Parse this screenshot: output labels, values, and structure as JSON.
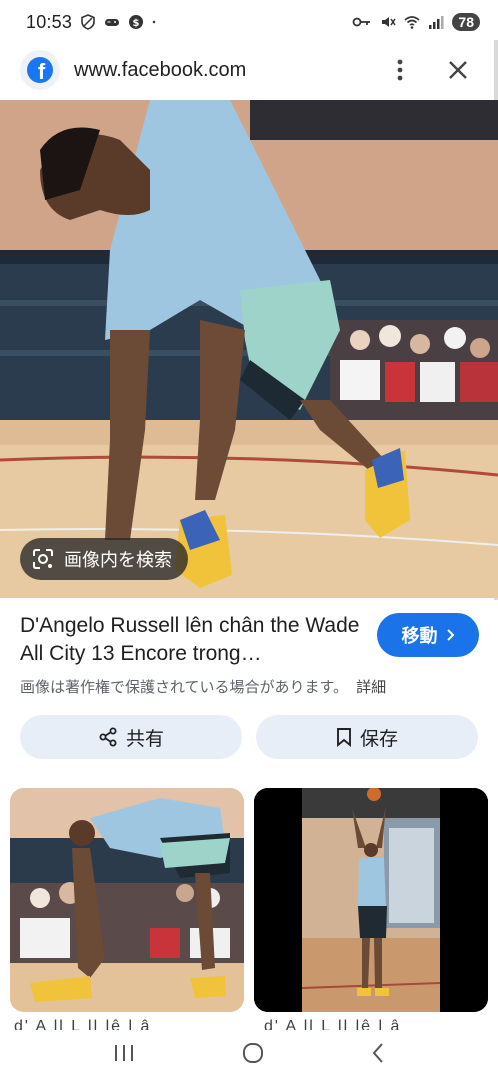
{
  "status_bar": {
    "time": "10:53",
    "battery": "78",
    "left_icons": [
      "shield-icon",
      "game-controller-icon",
      "dollar-circle-icon",
      "dot-icon"
    ],
    "right_icons": [
      "key-icon",
      "mute-icon",
      "wifi-icon",
      "signal-icon"
    ]
  },
  "browser": {
    "url": "www.facebook.com",
    "site_icon": "facebook-logo",
    "menu_icon": "more-vert-icon",
    "close_icon": "close-icon"
  },
  "image_viewer": {
    "lens_label": "画像内を検索",
    "title": "D'Angelo Russell lên chân the Wade All City 13 Encore trong…",
    "visit_label": "移動",
    "copyright_notice": "画像は著作権で保護されている場合があります。",
    "details_link": "詳細",
    "share_label": "共有",
    "save_label": "保存"
  },
  "related": {
    "captions": [
      "d' A ll L ll lê l â",
      "d' A ll L ll lê l â"
    ]
  },
  "colors": {
    "accent": "#1a73e8",
    "chip_bg": "#e8eef8",
    "facebook": "#1877f2"
  }
}
